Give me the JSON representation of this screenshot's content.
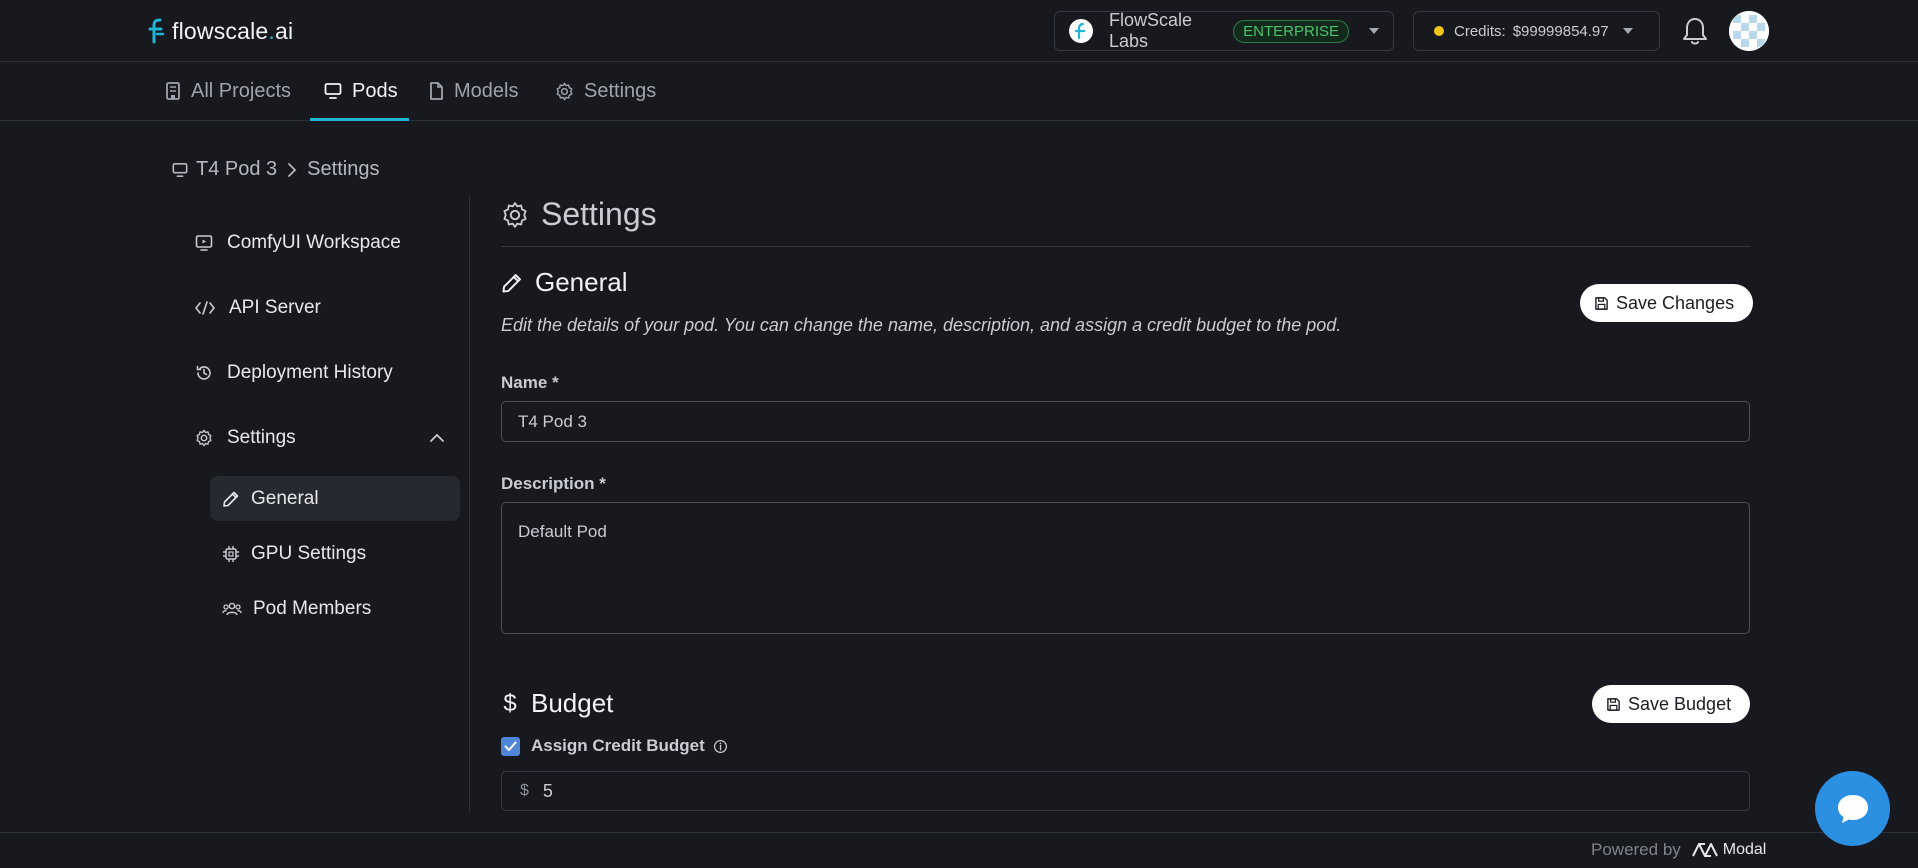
{
  "topbar": {
    "brand_main": "flowscale",
    "brand_dot": ".",
    "brand_suffix": "ai",
    "org_name": "FlowScale Labs",
    "org_badge": "ENTERPRISE",
    "credits_label": "Credits:",
    "credits_value": "$99999854.97"
  },
  "tabs": [
    {
      "label": "All Projects",
      "icon": "building-icon"
    },
    {
      "label": "Pods",
      "icon": "monitor-icon"
    },
    {
      "label": "Models",
      "icon": "file-icon"
    },
    {
      "label": "Settings",
      "icon": "gear-icon"
    }
  ],
  "breadcrumb": {
    "pod": "T4 Pod 3",
    "page": "Settings"
  },
  "sidebar": {
    "items": [
      {
        "label": "ComfyUI Workspace",
        "icon": "screen-play-icon"
      },
      {
        "label": "API Server",
        "icon": "code-icon"
      },
      {
        "label": "Deployment History",
        "icon": "history-icon"
      },
      {
        "label": "Settings",
        "icon": "gear-icon"
      }
    ],
    "sub_items": [
      {
        "label": "General",
        "icon": "pencil-icon"
      },
      {
        "label": "GPU Settings",
        "icon": "chip-icon"
      },
      {
        "label": "Pod Members",
        "icon": "users-icon"
      }
    ]
  },
  "main": {
    "title": "Settings",
    "general_title": "General",
    "general_desc": "Edit the details of your pod. You can change the name, description, and assign a credit budget to the pod.",
    "save_changes": "Save Changes",
    "name_label": "Name *",
    "name_value": "T4 Pod 3",
    "description_label": "Description *",
    "description_value": "Default Pod",
    "budget_title": "Budget",
    "save_budget": "Save Budget",
    "assign_label": "Assign Credit Budget",
    "budget_prefix": "$",
    "budget_value": "5"
  },
  "footer": {
    "powered_by": "Powered by",
    "provider": "Modal"
  },
  "colors": {
    "accent": "#1fb6d6",
    "background": "#17191e",
    "checkbox": "#4f86d8",
    "chat": "#2b8fe2",
    "badge_green": "#4cc46f"
  }
}
